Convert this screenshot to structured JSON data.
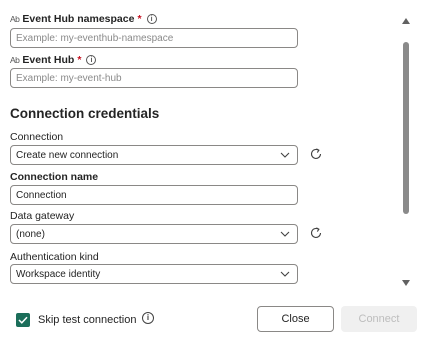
{
  "fields": {
    "event_hub_namespace": {
      "label": "Event Hub namespace",
      "required_mark": "*",
      "placeholder": "Example: my-eventhub-namespace",
      "value": ""
    },
    "event_hub": {
      "label": "Event Hub",
      "required_mark": "*",
      "placeholder": "Example: my-event-hub",
      "value": ""
    }
  },
  "credentials": {
    "section_title": "Connection credentials",
    "connection": {
      "label": "Connection",
      "value": "Create new connection"
    },
    "connection_name": {
      "label": "Connection name",
      "value": "Connection"
    },
    "data_gateway": {
      "label": "Data gateway",
      "value": "(none)"
    },
    "authentication_kind": {
      "label": "Authentication kind",
      "value": "Workspace identity"
    }
  },
  "icons": {
    "text_field": "Ab",
    "info": "i"
  },
  "footer": {
    "skip_test_label": "Skip test connection",
    "skip_test_checked": true,
    "close_label": "Close",
    "connect_label": "Connect"
  },
  "colors": {
    "accent": "#1b6e5a",
    "required": "#c50f1f",
    "disabled_bg": "#f0f0f0",
    "disabled_text": "#bdbdbd"
  }
}
